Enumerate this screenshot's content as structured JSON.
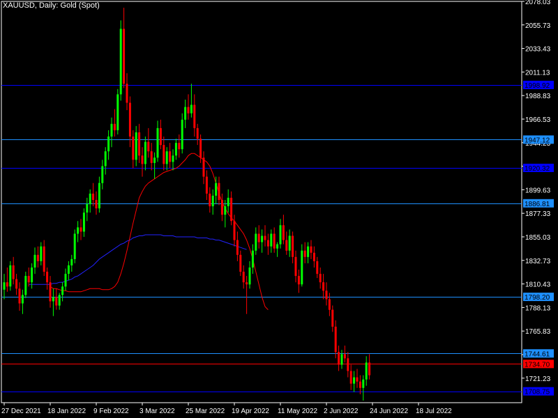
{
  "title": "XAUUSD, Daily:  Gold (Spot)",
  "colors": {
    "background": "#000000",
    "axis": "#ffffff",
    "bull": "#00ff00",
    "bear": "#ff0000",
    "ma_fast": "#ff0000",
    "ma_slow": "#2222ff",
    "hline_blue": "#0000ff",
    "hline_lightblue": "#1e90ff",
    "hline_red": "#ff0000"
  },
  "chart_data": {
    "type": "candlestick",
    "symbol": "XAUUSD",
    "timeframe": "Daily",
    "ylim": [
      1698.0,
      2078.0
    ],
    "y_ticks": [
      "2078.03",
      "2055.73",
      "2033.43",
      "2011.13",
      "1988.83",
      "1966.53",
      "1944.23",
      "1921.93",
      "1899.63",
      "1877.33",
      "1855.03",
      "1832.73",
      "1810.43",
      "1788.13",
      "1765.83",
      "1743.53",
      "1721.23"
    ],
    "x_ticks": [
      "27 Dec 2021",
      "18 Jan 2022",
      "9 Feb 2022",
      "3 Mar 2022",
      "25 Mar 2022",
      "19 Apr 2022",
      "11 May 2022",
      "2 Jun 2022",
      "24 Jun 2022",
      "18 Jul 2022"
    ],
    "x_tick_bar_index": [
      0,
      15,
      30,
      45,
      60,
      75,
      90,
      105,
      120,
      135
    ],
    "horizontal_lines": [
      {
        "value": 1998.92,
        "label": "1998.92",
        "color": "blue"
      },
      {
        "value": 1947.12,
        "label": "1947.12",
        "color": "lightblue"
      },
      {
        "value": 1920.32,
        "label": "1920.32",
        "color": "blue"
      },
      {
        "value": 1886.81,
        "label": "1886.81",
        "color": "lightblue"
      },
      {
        "value": 1798.2,
        "label": "1798.20",
        "color": "lightblue"
      },
      {
        "value": 1744.61,
        "label": "1744.61",
        "color": "lightblue"
      },
      {
        "value": 1734.7,
        "label": "1734.70",
        "color": "red"
      },
      {
        "value": 1708.75,
        "label": "1708.75",
        "color": "blue"
      }
    ],
    "candles": [
      [
        1805,
        1820,
        1796,
        1812
      ],
      [
        1812,
        1826,
        1803,
        1808
      ],
      [
        1808,
        1832,
        1804,
        1828
      ],
      [
        1828,
        1836,
        1810,
        1815
      ],
      [
        1815,
        1820,
        1800,
        1806
      ],
      [
        1806,
        1812,
        1785,
        1792
      ],
      [
        1792,
        1805,
        1782,
        1800
      ],
      [
        1800,
        1822,
        1797,
        1818
      ],
      [
        1818,
        1826,
        1808,
        1812
      ],
      [
        1812,
        1830,
        1806,
        1826
      ],
      [
        1826,
        1845,
        1820,
        1838
      ],
      [
        1838,
        1846,
        1826,
        1832
      ],
      [
        1832,
        1850,
        1828,
        1846
      ],
      [
        1846,
        1852,
        1818,
        1822
      ],
      [
        1822,
        1826,
        1805,
        1812
      ],
      [
        1812,
        1818,
        1788,
        1794
      ],
      [
        1794,
        1806,
        1780,
        1798
      ],
      [
        1798,
        1806,
        1786,
        1790
      ],
      [
        1790,
        1802,
        1786,
        1800
      ],
      [
        1800,
        1812,
        1794,
        1808
      ],
      [
        1808,
        1825,
        1804,
        1820
      ],
      [
        1820,
        1832,
        1814,
        1828
      ],
      [
        1828,
        1838,
        1822,
        1834
      ],
      [
        1834,
        1862,
        1830,
        1858
      ],
      [
        1858,
        1870,
        1850,
        1864
      ],
      [
        1864,
        1872,
        1852,
        1860
      ],
      [
        1860,
        1882,
        1855,
        1878
      ],
      [
        1878,
        1892,
        1870,
        1886
      ],
      [
        1886,
        1900,
        1878,
        1896
      ],
      [
        1896,
        1906,
        1884,
        1890
      ],
      [
        1890,
        1898,
        1876,
        1882
      ],
      [
        1882,
        1912,
        1878,
        1906
      ],
      [
        1906,
        1928,
        1900,
        1922
      ],
      [
        1922,
        1940,
        1914,
        1936
      ],
      [
        1936,
        1956,
        1928,
        1950
      ],
      [
        1950,
        1968,
        1940,
        1962
      ],
      [
        1962,
        1976,
        1950,
        1956
      ],
      [
        1956,
        1995,
        1952,
        1990
      ],
      [
        1990,
        2060,
        1984,
        2052
      ],
      [
        2052,
        2072,
        1996,
        2000
      ],
      [
        2000,
        2010,
        1975,
        1982
      ],
      [
        1982,
        1988,
        1940,
        1950
      ],
      [
        1950,
        1956,
        1920,
        1928
      ],
      [
        1928,
        1960,
        1922,
        1954
      ],
      [
        1954,
        1962,
        1925,
        1932
      ],
      [
        1932,
        1940,
        1912,
        1924
      ],
      [
        1924,
        1950,
        1918,
        1945
      ],
      [
        1945,
        1958,
        1930,
        1936
      ],
      [
        1936,
        1944,
        1918,
        1925
      ],
      [
        1925,
        1935,
        1910,
        1930
      ],
      [
        1930,
        1965,
        1926,
        1958
      ],
      [
        1958,
        1966,
        1938,
        1942
      ],
      [
        1942,
        1950,
        1918,
        1924
      ],
      [
        1924,
        1940,
        1918,
        1936
      ],
      [
        1936,
        1944,
        1920,
        1926
      ],
      [
        1926,
        1938,
        1918,
        1932
      ],
      [
        1932,
        1948,
        1928,
        1944
      ],
      [
        1944,
        1952,
        1930,
        1938
      ],
      [
        1938,
        1972,
        1934,
        1966
      ],
      [
        1966,
        1985,
        1958,
        1978
      ],
      [
        1978,
        1990,
        1966,
        1972
      ],
      [
        1972,
        2000,
        1968,
        1980
      ],
      [
        1980,
        1990,
        1950,
        1958
      ],
      [
        1958,
        1962,
        1942,
        1948
      ],
      [
        1948,
        1952,
        1925,
        1930
      ],
      [
        1930,
        1936,
        1905,
        1912
      ],
      [
        1912,
        1918,
        1890,
        1896
      ],
      [
        1896,
        1902,
        1878,
        1884
      ],
      [
        1884,
        1900,
        1876,
        1894
      ],
      [
        1894,
        1912,
        1886,
        1906
      ],
      [
        1906,
        1912,
        1885,
        1890
      ],
      [
        1890,
        1896,
        1870,
        1876
      ],
      [
        1876,
        1890,
        1864,
        1884
      ],
      [
        1884,
        1900,
        1878,
        1892
      ],
      [
        1892,
        1898,
        1866,
        1870
      ],
      [
        1870,
        1876,
        1846,
        1852
      ],
      [
        1852,
        1860,
        1832,
        1838
      ],
      [
        1838,
        1842,
        1818,
        1822
      ],
      [
        1822,
        1828,
        1806,
        1812
      ],
      [
        1812,
        1818,
        1782,
        1810
      ],
      [
        1810,
        1832,
        1806,
        1826
      ],
      [
        1826,
        1848,
        1820,
        1842
      ],
      [
        1842,
        1864,
        1838,
        1858
      ],
      [
        1858,
        1866,
        1844,
        1850
      ],
      [
        1850,
        1862,
        1840,
        1856
      ],
      [
        1856,
        1866,
        1846,
        1852
      ],
      [
        1852,
        1858,
        1838,
        1846
      ],
      [
        1846,
        1862,
        1840,
        1858
      ],
      [
        1858,
        1864,
        1840,
        1844
      ],
      [
        1844,
        1850,
        1836,
        1848
      ],
      [
        1848,
        1872,
        1844,
        1866
      ],
      [
        1866,
        1876,
        1848,
        1852
      ],
      [
        1852,
        1860,
        1838,
        1842
      ],
      [
        1842,
        1862,
        1836,
        1856
      ],
      [
        1856,
        1860,
        1830,
        1836
      ],
      [
        1836,
        1842,
        1812,
        1818
      ],
      [
        1818,
        1824,
        1802,
        1810
      ],
      [
        1810,
        1848,
        1808,
        1842
      ],
      [
        1842,
        1850,
        1830,
        1836
      ],
      [
        1836,
        1850,
        1830,
        1846
      ],
      [
        1846,
        1852,
        1834,
        1840
      ],
      [
        1840,
        1846,
        1826,
        1832
      ],
      [
        1832,
        1836,
        1816,
        1820
      ],
      [
        1820,
        1826,
        1806,
        1812
      ],
      [
        1812,
        1820,
        1796,
        1804
      ],
      [
        1804,
        1812,
        1790,
        1796
      ],
      [
        1796,
        1802,
        1780,
        1786
      ],
      [
        1786,
        1790,
        1765,
        1770
      ],
      [
        1770,
        1776,
        1740,
        1746
      ],
      [
        1746,
        1752,
        1728,
        1734
      ],
      [
        1734,
        1748,
        1730,
        1744
      ],
      [
        1744,
        1752,
        1736,
        1740
      ],
      [
        1740,
        1746,
        1722,
        1728
      ],
      [
        1728,
        1734,
        1710,
        1716
      ],
      [
        1716,
        1728,
        1708,
        1722
      ],
      [
        1722,
        1730,
        1712,
        1718
      ],
      [
        1718,
        1724,
        1706,
        1712
      ],
      [
        1712,
        1724,
        1700,
        1720
      ],
      [
        1720,
        1742,
        1714,
        1736
      ],
      [
        1736,
        1744,
        1720,
        1724
      ]
    ],
    "ma_fast": [
      1808,
      1806,
      1806,
      1805,
      1804,
      1804,
      1803,
      1803,
      1803,
      1803,
      1803,
      1804,
      1805,
      1806,
      1806,
      1806,
      1806,
      1805,
      1805,
      1805,
      1806,
      1808,
      1812,
      1820,
      1830,
      1842,
      1855,
      1868,
      1880,
      1892,
      1898,
      1903,
      1906,
      1908,
      1910,
      1912,
      1914,
      1916,
      1917,
      1918,
      1919,
      1920,
      1922,
      1925,
      1928,
      1932,
      1934,
      1934,
      1932,
      1930,
      1928,
      1926,
      1922,
      1915,
      1906,
      1896,
      1888,
      1882,
      1877,
      1873,
      1870,
      1866,
      1862,
      1858,
      1852,
      1844,
      1834,
      1822,
      1810,
      1798,
      1789,
      1786
    ],
    "ma_slow": [
      1810,
      1810,
      1810,
      1810,
      1810,
      1810,
      1810,
      1810,
      1811,
      1811,
      1812,
      1812,
      1813,
      1814,
      1815,
      1817,
      1818,
      1820,
      1822,
      1824,
      1826,
      1828,
      1831,
      1834,
      1836,
      1838,
      1840,
      1842,
      1844,
      1846,
      1848,
      1849,
      1851,
      1852,
      1854,
      1855,
      1856,
      1856,
      1857,
      1857,
      1857,
      1857,
      1857,
      1857,
      1856,
      1856,
      1856,
      1856,
      1855,
      1855,
      1855,
      1855,
      1855,
      1855,
      1855,
      1854,
      1854,
      1854,
      1854,
      1853,
      1853,
      1852,
      1852,
      1851,
      1850,
      1849,
      1848,
      1847,
      1846,
      1845,
      1844,
      1843
    ]
  }
}
